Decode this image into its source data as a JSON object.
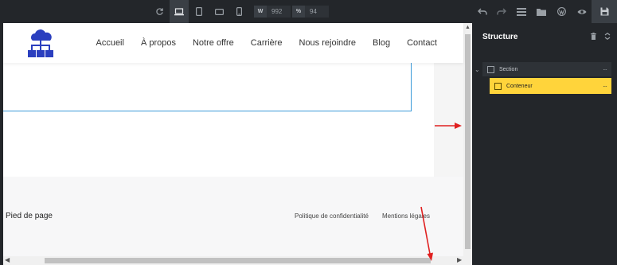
{
  "toolbar": {
    "width_tag": "W",
    "width_value": "992",
    "zoom_tag": "%",
    "zoom_value": "94"
  },
  "site": {
    "nav": [
      "Accueil",
      "À propos",
      "Notre offre",
      "Carrière",
      "Nous rejoindre",
      "Blog",
      "Contact"
    ],
    "footer_title": "Pied de page",
    "footer_links": [
      "Politique de confidentialité",
      "Mentions légales"
    ]
  },
  "panel": {
    "title": "Structure",
    "tree": [
      {
        "label": "Section",
        "more": "···"
      },
      {
        "label": "Conteneur",
        "more": "···"
      }
    ]
  },
  "colors": {
    "accent_selected": "#ffd43b",
    "logo_blue": "#2b3fbf",
    "annotation_red": "#e02020",
    "outline_blue": "#3a9ad9"
  }
}
